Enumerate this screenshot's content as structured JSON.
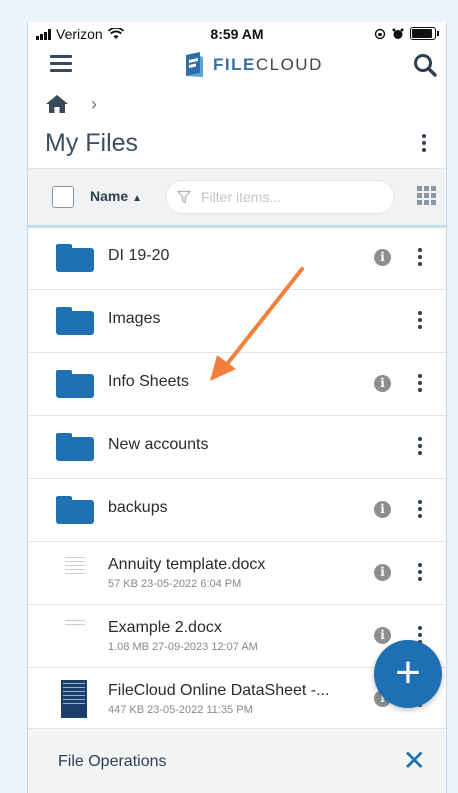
{
  "status_bar": {
    "carrier": "Verizon",
    "time": "8:59 AM"
  },
  "header": {
    "brand_bold": "FILE",
    "brand_rest": "CLOUD"
  },
  "breadcrumb": {
    "home_icon": "home-icon",
    "separator": "›"
  },
  "page": {
    "title": "My Files"
  },
  "toolbar": {
    "sort_label": "Name",
    "sort_arrow": "▲",
    "filter_placeholder": "Filter items..."
  },
  "items": [
    {
      "type": "folder",
      "name": "DI 19-20",
      "has_info": true
    },
    {
      "type": "folder",
      "name": "Images",
      "has_info": false
    },
    {
      "type": "folder",
      "name": "Info Sheets",
      "has_info": true
    },
    {
      "type": "folder",
      "name": "New accounts",
      "has_info": false
    },
    {
      "type": "folder",
      "name": "backups",
      "has_info": true
    },
    {
      "type": "file",
      "name": "Annuity template.docx",
      "meta": "57 KB 23-05-2022 6:04 PM",
      "has_info": true
    },
    {
      "type": "file",
      "name": "Example 2.docx",
      "meta": "1.08 MB 27-09-2023 12:07 AM",
      "has_info": true
    },
    {
      "type": "file",
      "name": "FileCloud Online DataSheet -...",
      "meta": "447 KB 23-05-2022 11:35 PM",
      "has_info": true
    }
  ],
  "fab": {
    "label": "+"
  },
  "file_operations": {
    "label": "File Operations",
    "close": "✕"
  },
  "colors": {
    "accent": "#1f6fb3",
    "annotation_arrow": "#f0803c"
  }
}
